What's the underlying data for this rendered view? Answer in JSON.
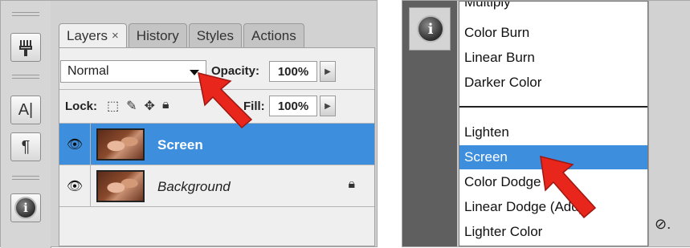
{
  "left_panel": {
    "tabs": [
      {
        "label": "Layers",
        "close": "×",
        "active": true
      },
      {
        "label": "History",
        "active": false
      },
      {
        "label": "Styles",
        "active": false
      },
      {
        "label": "Actions",
        "active": false
      }
    ],
    "blend_mode": "Normal",
    "opacity_label": "Opacity:",
    "opacity_value": "100%",
    "lock_label": "Lock:",
    "fill_label": "Fill:",
    "fill_value": "100%",
    "layers": [
      {
        "name": "Screen",
        "selected": true
      },
      {
        "name": "Background",
        "selected": false,
        "locked": true
      }
    ],
    "toolstrip_icons": [
      "brush-presets-icon",
      "character-icon",
      "paragraph-icon",
      "info-icon"
    ],
    "character_glyph": "A|",
    "paragraph_glyph": "¶"
  },
  "right_panel": {
    "menu_items": [
      {
        "label": "Multiply",
        "highlighted": false
      },
      {
        "label": "Color Burn",
        "highlighted": false
      },
      {
        "label": "Linear Burn",
        "highlighted": false
      },
      {
        "label": "Darker Color",
        "highlighted": false
      },
      {
        "label": "Lighten",
        "highlighted": false
      },
      {
        "label": "Screen",
        "highlighted": true
      },
      {
        "label": "Color Dodge",
        "highlighted": false
      },
      {
        "label": "Linear Dodge (Add)",
        "highlighted": false
      },
      {
        "label": "Lighter Color",
        "highlighted": false
      }
    ],
    "info_glyph": "i",
    "fx_glyph": "⊘."
  },
  "colors": {
    "selection_blue": "#3d8fde",
    "arrow_red": "#e8261c"
  }
}
